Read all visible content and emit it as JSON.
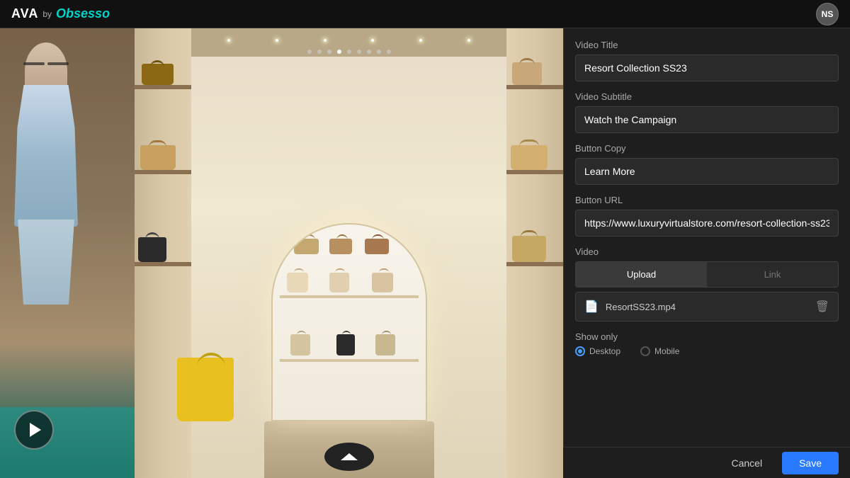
{
  "header": {
    "logo_ava": "AVA",
    "logo_by": "by",
    "logo_obsesso": "Obsesso",
    "avatar_initials": "NS"
  },
  "fields": {
    "video_title_label": "Video Title",
    "video_title_value": "Resort Collection SS23",
    "video_subtitle_label": "Video Subtitle",
    "video_subtitle_value": "Watch the Campaign",
    "button_copy_label": "Button Copy",
    "button_copy_value": "Learn More",
    "button_url_label": "Button URL",
    "button_url_value": "https://www.luxuryvirtualstore.com/resort-collection-ss23",
    "video_label": "Video",
    "upload_label": "Upload",
    "link_label": "Link",
    "file_name": "ResortSS23.mp4",
    "show_only_label": "Show only",
    "option_desktop": "Desktop",
    "option_mobile": "Mobile"
  },
  "actions": {
    "cancel_label": "Cancel",
    "save_label": "Save"
  }
}
